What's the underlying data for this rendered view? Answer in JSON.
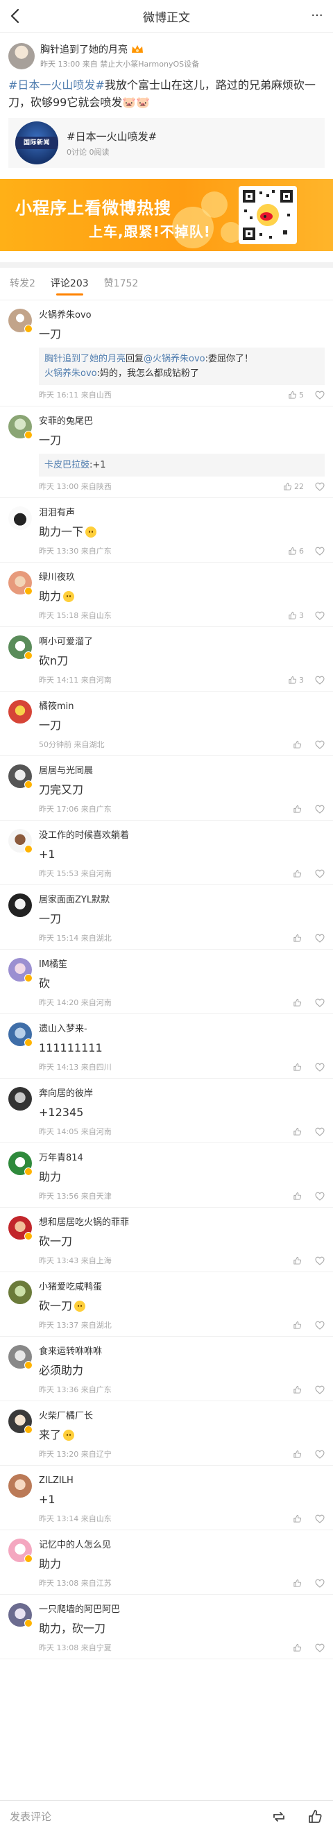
{
  "topbar": {
    "title": "微博正文"
  },
  "post": {
    "user": "胸针追到了她的月亮",
    "time": "昨天 13:00",
    "source": "来自 禁止大小篆HarmonyOS设备",
    "text_link": "#日本一火山喷发#",
    "text_body": "我放个富士山在这儿，路过的兄弟麻烦砍一刀，砍够99它就会喷发🐷🐷",
    "topic": {
      "title": "#日本一火山喷发#",
      "stats": "0讨论 0阅读",
      "thumb_text": "国际新闻"
    },
    "banner": {
      "line1": "小程序上看微博热搜",
      "line2": "上车,跟紧!不掉队!"
    }
  },
  "tabs": [
    {
      "label": "转发2"
    },
    {
      "label": "评论203"
    },
    {
      "label": "赞1752"
    }
  ],
  "comments": [
    {
      "name": "火锅养朱ovo",
      "text": "一刀",
      "time": "昨天 16:11 来自山西",
      "likes": "5",
      "reply": {
        "a": "胸针追到了她的月亮",
        "mid": "回复",
        "b": "@火锅养朱ovo",
        "t1": ":委屈你了！",
        "c": "火锅养朱ovo",
        "t2": ":妈的，我怎么都成钻粉了"
      }
    },
    {
      "name": "安菲的兔尾巴",
      "text": "一刀",
      "time": "昨天 13:00 来自陕西",
      "likes": "22",
      "reply2": {
        "a": "卡皮巴拉鼓",
        "t": ":+1"
      }
    },
    {
      "name": "泪泪有声",
      "text": "助力一下",
      "time": "昨天 13:30 来自广东",
      "likes": "6",
      "emoji": true
    },
    {
      "name": "绿川夜玖",
      "text": "助力",
      "time": "昨天 15:18 来自山东",
      "likes": "3",
      "emoji": true
    },
    {
      "name": "啊小可爱溜了",
      "text": "砍n刀",
      "time": "昨天 14:11 来自河南",
      "likes": "3"
    },
    {
      "name": "橘筱min",
      "text": "一刀",
      "time": "50分钟前 来自湖北",
      "likes": ""
    },
    {
      "name": "居居与光同晨",
      "text": "刀完又刀",
      "time": "昨天 17:06 来自广东",
      "likes": ""
    },
    {
      "name": "没工作的时候喜欢躺着",
      "text": "+1",
      "time": "昨天 15:53 来自河南",
      "likes": ""
    },
    {
      "name": "居家面面ZYL默默",
      "text": "一刀",
      "time": "昨天 15:14 来自湖北",
      "likes": ""
    },
    {
      "name": "IM橘笙",
      "text": "砍",
      "time": "昨天 14:20 来自河南",
      "likes": ""
    },
    {
      "name": "遗山入梦来-",
      "text": "111111111",
      "time": "昨天 14:13 来自四川",
      "likes": ""
    },
    {
      "name": "奔向居的彼岸",
      "text": "+12345",
      "time": "昨天 14:05 来自河南",
      "likes": ""
    },
    {
      "name": "万年青814",
      "text": "助力",
      "time": "昨天 13:56 来自天津",
      "likes": ""
    },
    {
      "name": "想和居居吃火锅的菲菲",
      "text": "砍一刀",
      "time": "昨天 13:43 来自上海",
      "likes": ""
    },
    {
      "name": "小猪爱吃咸鸭蛋",
      "text": "砍一刀",
      "time": "昨天 13:37 来自湖北",
      "likes": "",
      "emoji": true
    },
    {
      "name": "食来运转咻咻咻",
      "text": "必须助力",
      "time": "昨天 13:36 来自广东",
      "likes": ""
    },
    {
      "name": "火柴厂橘厂长",
      "text": "来了",
      "time": "昨天 13:20 来自辽宁",
      "likes": "",
      "emoji": true
    },
    {
      "name": "ZILZILH",
      "text": " +1",
      "time": "昨天 13:14 来自山东",
      "likes": ""
    },
    {
      "name": "记忆中的人怎么见",
      "text": "助力",
      "time": "昨天 13:08 来自江苏",
      "likes": ""
    },
    {
      "name": "一只爬墙的阿巴阿巴",
      "text": "助力，砍一刀",
      "time": "昨天 13:08 来自宁夏",
      "likes": ""
    }
  ],
  "footer": {
    "placeholder": "发表评论"
  }
}
